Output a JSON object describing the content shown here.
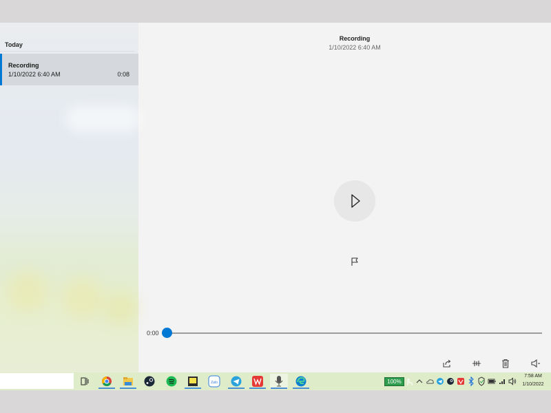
{
  "sidebar": {
    "section_title": "Today",
    "recordings": [
      {
        "name": "Recording",
        "date": "1/10/2022 6:40 AM",
        "duration": "0:08"
      }
    ]
  },
  "main": {
    "title": "Recording",
    "subtitle": "1/10/2022 6:40 AM",
    "play_icon": "play-icon",
    "flag_icon": "flag-icon"
  },
  "player": {
    "current_time": "0:00",
    "progress": 0
  },
  "toolbar": {
    "icons": [
      "share-icon",
      "trim-icon",
      "delete-icon",
      "speaker-icon"
    ]
  },
  "taskbar": {
    "apps": [
      "task-view-icon",
      "chrome-icon",
      "file-explorer-icon",
      "steam-icon",
      "spotify-icon",
      "sticky-notes-icon",
      "zalo-icon",
      "telegram-icon",
      "wps-office-icon",
      "voice-recorder-icon",
      "edge-icon"
    ],
    "battery": "100%",
    "clock_time": "7:58 AM",
    "clock_date": "1/10/2022"
  },
  "colors": {
    "accent": "#0078d4",
    "taskbar": "#dfecc9",
    "battery": "#2e9e4e"
  }
}
